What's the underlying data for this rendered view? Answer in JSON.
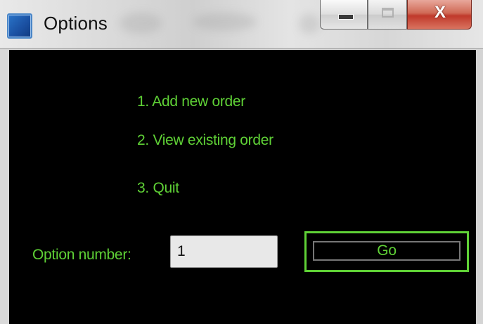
{
  "window": {
    "title": "Options",
    "icon": "app-window-icon",
    "caption": {
      "minimize_icon": "minimize-icon",
      "maximize_icon": "maximize-icon",
      "close_glyph": "X"
    }
  },
  "menu": {
    "items": [
      {
        "label": "1. Add new order"
      },
      {
        "label": "2. View existing order"
      },
      {
        "label": "3. Quit"
      }
    ]
  },
  "form": {
    "option_label": "Option number:",
    "option_value": "1",
    "go_label": "Go"
  },
  "colors": {
    "text_accent": "#5fd136",
    "client_background": "#000000",
    "close_button": "#c0392b"
  }
}
